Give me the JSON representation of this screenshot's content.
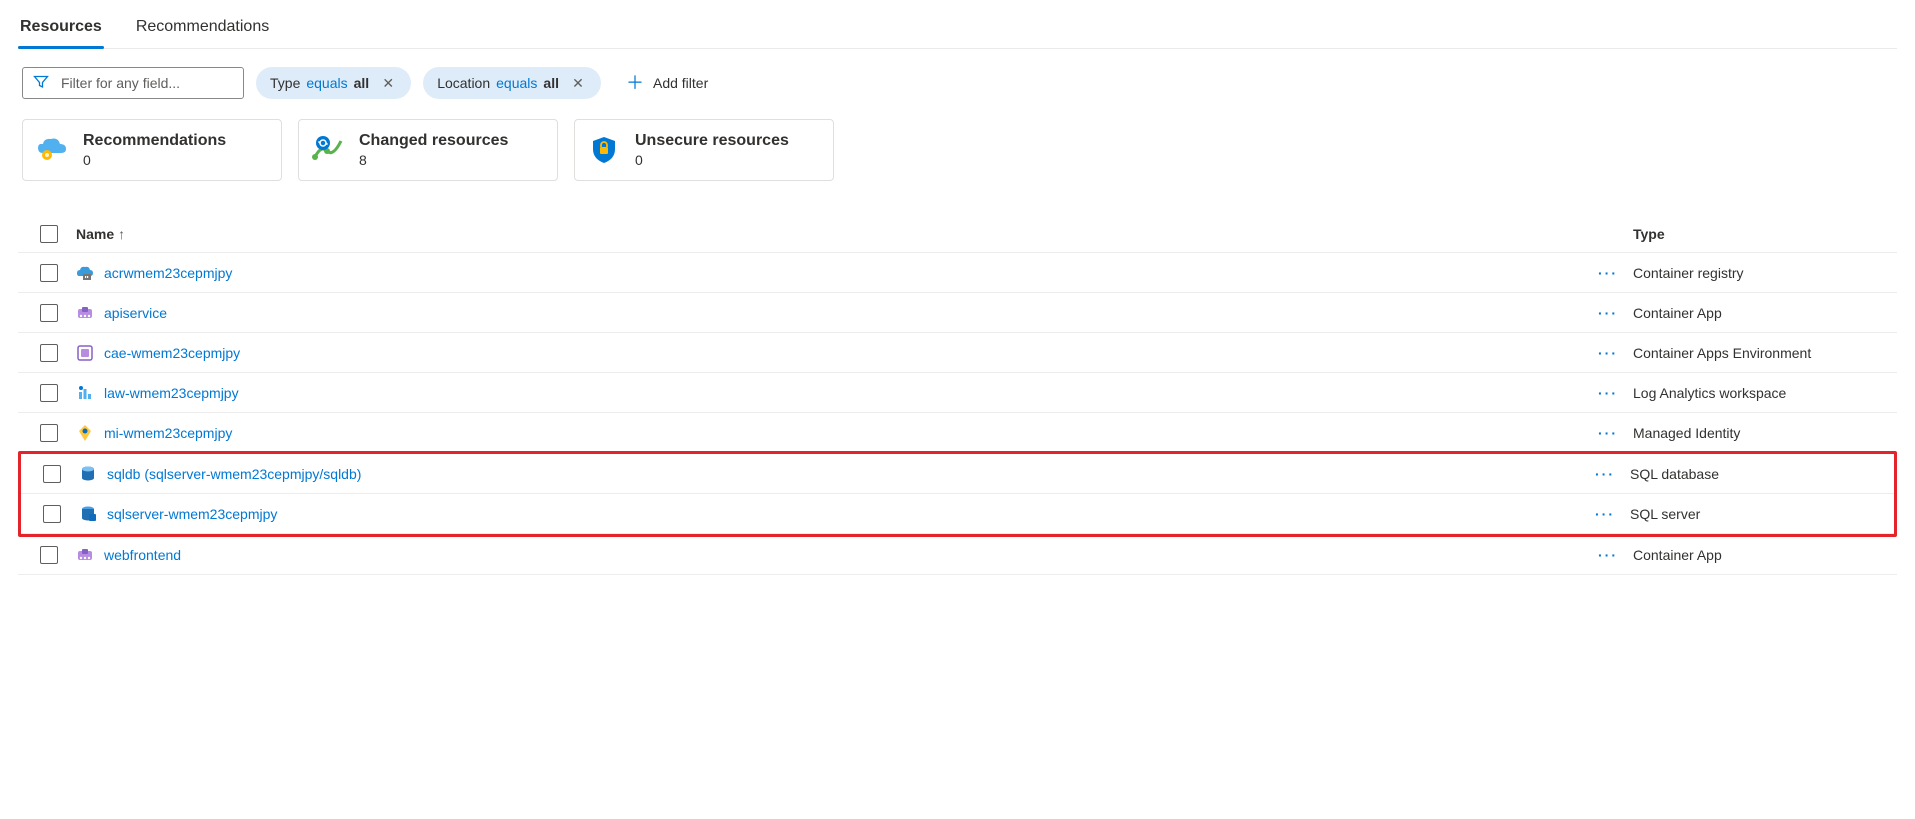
{
  "tabs": {
    "resources": "Resources",
    "recommendations": "Recommendations"
  },
  "filter": {
    "placeholder": "Filter for any field..."
  },
  "pills": {
    "type": {
      "key": "Type",
      "op": "equals",
      "value": "all"
    },
    "location": {
      "key": "Location",
      "op": "equals",
      "value": "all"
    }
  },
  "add_filter_label": "Add filter",
  "cards": {
    "recommendations": {
      "title": "Recommendations",
      "count": "0"
    },
    "changed": {
      "title": "Changed resources",
      "count": "8"
    },
    "unsecure": {
      "title": "Unsecure resources",
      "count": "0"
    }
  },
  "columns": {
    "name": "Name",
    "type": "Type"
  },
  "more_label": "···",
  "rows": [
    {
      "name": "acrwmem23cepmjpy",
      "type": "Container registry",
      "icon": "acr",
      "highlight": false
    },
    {
      "name": "apiservice",
      "type": "Container App",
      "icon": "capp",
      "highlight": false
    },
    {
      "name": "cae-wmem23cepmjpy",
      "type": "Container Apps Environment",
      "icon": "cae",
      "highlight": false
    },
    {
      "name": "law-wmem23cepmjpy",
      "type": "Log Analytics workspace",
      "icon": "law",
      "highlight": false
    },
    {
      "name": "mi-wmem23cepmjpy",
      "type": "Managed Identity",
      "icon": "mi",
      "highlight": false
    },
    {
      "name": "sqldb (sqlserver-wmem23cepmjpy/sqldb)",
      "type": "SQL database",
      "icon": "sqldb",
      "highlight": true
    },
    {
      "name": "sqlserver-wmem23cepmjpy",
      "type": "SQL server",
      "icon": "sqlsrv",
      "highlight": true
    },
    {
      "name": "webfrontend",
      "type": "Container App",
      "icon": "capp",
      "highlight": false
    }
  ]
}
